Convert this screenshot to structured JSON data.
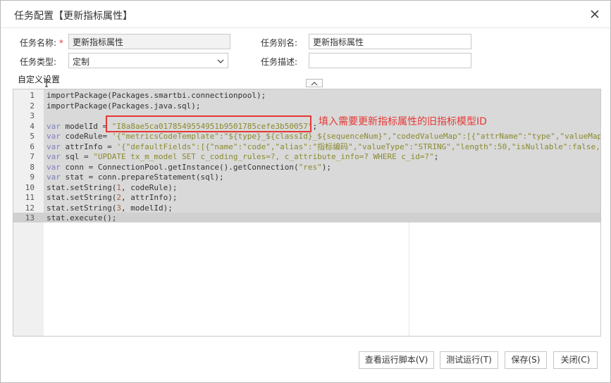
{
  "dialog": {
    "title": "任务配置【更新指标属性】"
  },
  "form": {
    "name_label": "任务名称:",
    "required_mark": "*",
    "name_value": "更新指标属性",
    "alias_label": "任务别名:",
    "alias_value": "更新指标属性",
    "type_label": "任务类型:",
    "type_value": "定制",
    "desc_label": "任务描述:",
    "desc_value": ""
  },
  "section": {
    "custom_settings": "自定义设置"
  },
  "editor": {
    "lines": [
      {
        "n": "1",
        "parts": [
          [
            "",
            "importPackage(Packages.smartbi.connectionpool);"
          ]
        ]
      },
      {
        "n": "2",
        "parts": [
          [
            "",
            "importPackage(Packages.java.sql);"
          ]
        ]
      },
      {
        "n": "3",
        "parts": [
          [
            "",
            ""
          ]
        ]
      },
      {
        "n": "4",
        "parts": [
          [
            "kw",
            "var"
          ],
          [
            "",
            " modelId = "
          ],
          [
            "str",
            "\"I8a8ae5ca0178549554951b9501785cefe3b50057\""
          ],
          [
            "",
            ";"
          ]
        ]
      },
      {
        "n": "5",
        "parts": [
          [
            "kw",
            "var"
          ],
          [
            "",
            " codeRule= "
          ],
          [
            "str",
            "'{\"metricsCodeTemplate\":\"${type}_${classId}_${sequenceNum}\",\"codedValueMap\":[{\"attrName\":\"type\",\"valueMap\":{\""
          ]
        ]
      },
      {
        "n": "6",
        "parts": [
          [
            "kw",
            "var"
          ],
          [
            "",
            " attrInfo = "
          ],
          [
            "str",
            "'{\"defaultFields\":[{\"name\":\"code\",\"alias\":\"指标编码\",\"valueType\":\"STRING\",\"length\":50,\"isNullable\":false,\"co"
          ]
        ]
      },
      {
        "n": "7",
        "parts": [
          [
            "kw",
            "var"
          ],
          [
            "",
            " sql = "
          ],
          [
            "str",
            "\"UPDATE tx_m_model SET c_coding_rules=?, c_attribute_info=? WHERE c_id=?\""
          ],
          [
            "",
            ";"
          ]
        ]
      },
      {
        "n": "8",
        "parts": [
          [
            "kw",
            "var"
          ],
          [
            "",
            " conn = ConnectionPool.getInstance().getConnection("
          ],
          [
            "str",
            "\"res\""
          ],
          [
            "",
            ");"
          ]
        ]
      },
      {
        "n": "9",
        "parts": [
          [
            "kw",
            "var"
          ],
          [
            "",
            " stat = conn.prepareStatement(sql);"
          ]
        ]
      },
      {
        "n": "10",
        "parts": [
          [
            "",
            "stat.setString("
          ],
          [
            "num",
            "1"
          ],
          [
            "",
            ", codeRule);"
          ]
        ]
      },
      {
        "n": "11",
        "parts": [
          [
            "",
            "stat.setString("
          ],
          [
            "num",
            "2"
          ],
          [
            "",
            ", attrInfo);"
          ]
        ]
      },
      {
        "n": "12",
        "parts": [
          [
            "",
            "stat.setString("
          ],
          [
            "num",
            "3"
          ],
          [
            "",
            ", modelId);"
          ]
        ]
      },
      {
        "n": "13",
        "parts": [
          [
            "",
            "stat.execute();"
          ]
        ]
      }
    ]
  },
  "annotation": {
    "text": "填入需要更新指标属性的旧指标模型ID",
    "color": "#e53935"
  },
  "buttons": {
    "view_script": "查看运行脚本(V)",
    "test_run": "测试运行(T)",
    "save": "保存(S)",
    "close": "关闭(C)"
  },
  "icons": {
    "close": "close-icon",
    "dropdown": "chevron-down-icon",
    "collapse": "chevron-up-icon"
  }
}
